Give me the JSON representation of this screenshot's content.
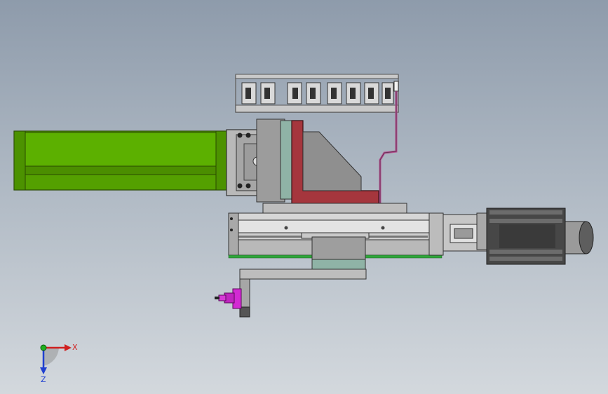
{
  "viewport": {
    "background_top": "#8e9bab",
    "background_bottom": "#d3d8dd"
  },
  "model": {
    "colors": {
      "green_arm": "#54a000",
      "green_arm_dark": "#3c7a00",
      "red_bracket": "#a5363d",
      "teal_plate": "#8fb3a6",
      "purple_cable": "#b0508e",
      "magenta_part": "#d32bd3",
      "grey_light": "#c4c4c4",
      "grey_mid": "#9a9a9a",
      "grey_dark": "#5a5a5a",
      "motor_dark": "#3c3c3c",
      "green_strip": "#2fa63a"
    }
  },
  "triad": {
    "x_label": "X",
    "z_label": "Z",
    "x_color": "#d02020",
    "y_color": "#20b020",
    "z_color": "#2040d0"
  }
}
